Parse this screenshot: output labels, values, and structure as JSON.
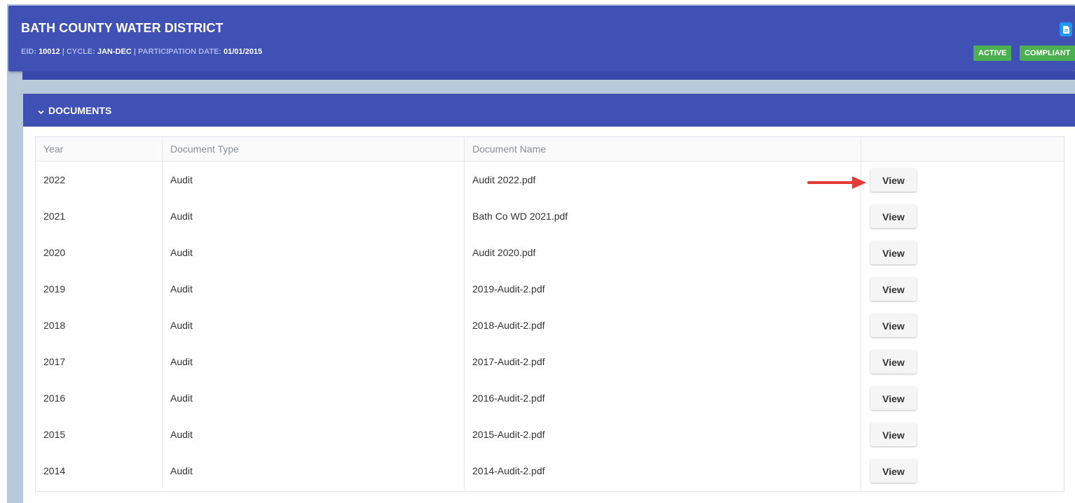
{
  "header": {
    "title": "BATH COUNTY WATER DISTRICT",
    "eid_label": "EID:",
    "eid_value": "10012",
    "cycle_label": "CYCLE:",
    "cycle_value": "JAN-DEC",
    "participation_label": "PARTICIPATION DATE:",
    "participation_value": "01/01/2015",
    "separator": "|",
    "badges": {
      "active": "ACTIVE",
      "compliant": "COMPLIANT"
    },
    "doc_icon": "document-icon"
  },
  "panel": {
    "title": "DOCUMENTS",
    "chevron_icon": "chevron-down-icon"
  },
  "table": {
    "columns": [
      "Year",
      "Document Type",
      "Document Name",
      ""
    ],
    "view_label": "View",
    "rows": [
      {
        "year": "2022",
        "type": "Audit",
        "name": "Audit 2022.pdf"
      },
      {
        "year": "2021",
        "type": "Audit",
        "name": "Bath Co WD 2021.pdf"
      },
      {
        "year": "2020",
        "type": "Audit",
        "name": "Audit 2020.pdf"
      },
      {
        "year": "2019",
        "type": "Audit",
        "name": "2019-Audit-2.pdf"
      },
      {
        "year": "2018",
        "type": "Audit",
        "name": "2018-Audit-2.pdf"
      },
      {
        "year": "2017",
        "type": "Audit",
        "name": "2017-Audit-2.pdf"
      },
      {
        "year": "2016",
        "type": "Audit",
        "name": "2016-Audit-2.pdf"
      },
      {
        "year": "2015",
        "type": "Audit",
        "name": "2015-Audit-2.pdf"
      },
      {
        "year": "2014",
        "type": "Audit",
        "name": "2014-Audit-2.pdf"
      }
    ]
  },
  "colors": {
    "primary": "#3f51b5",
    "badge_green": "#4caf50",
    "doc_button_blue": "#2196f3",
    "annotation_arrow": "#e53935"
  }
}
